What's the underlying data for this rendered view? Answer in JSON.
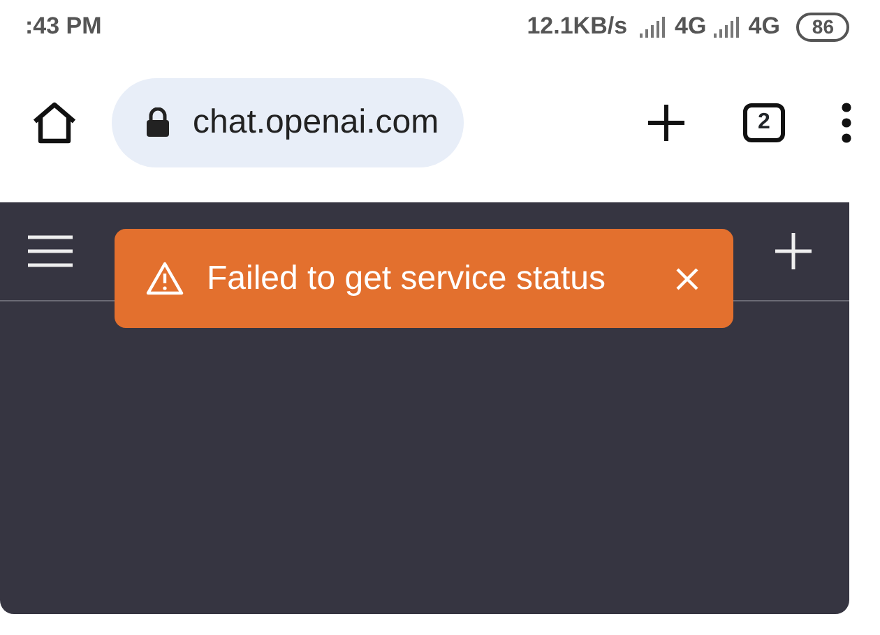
{
  "status_bar": {
    "time": ":43 PM",
    "network_speed": "12.1KB/s",
    "signals": [
      {
        "label": "4G"
      },
      {
        "label": "4G"
      }
    ],
    "battery": "86"
  },
  "browser_bar": {
    "url": "chat.openai.com",
    "tab_count": "2"
  },
  "toast": {
    "message": "Failed to get service status"
  }
}
